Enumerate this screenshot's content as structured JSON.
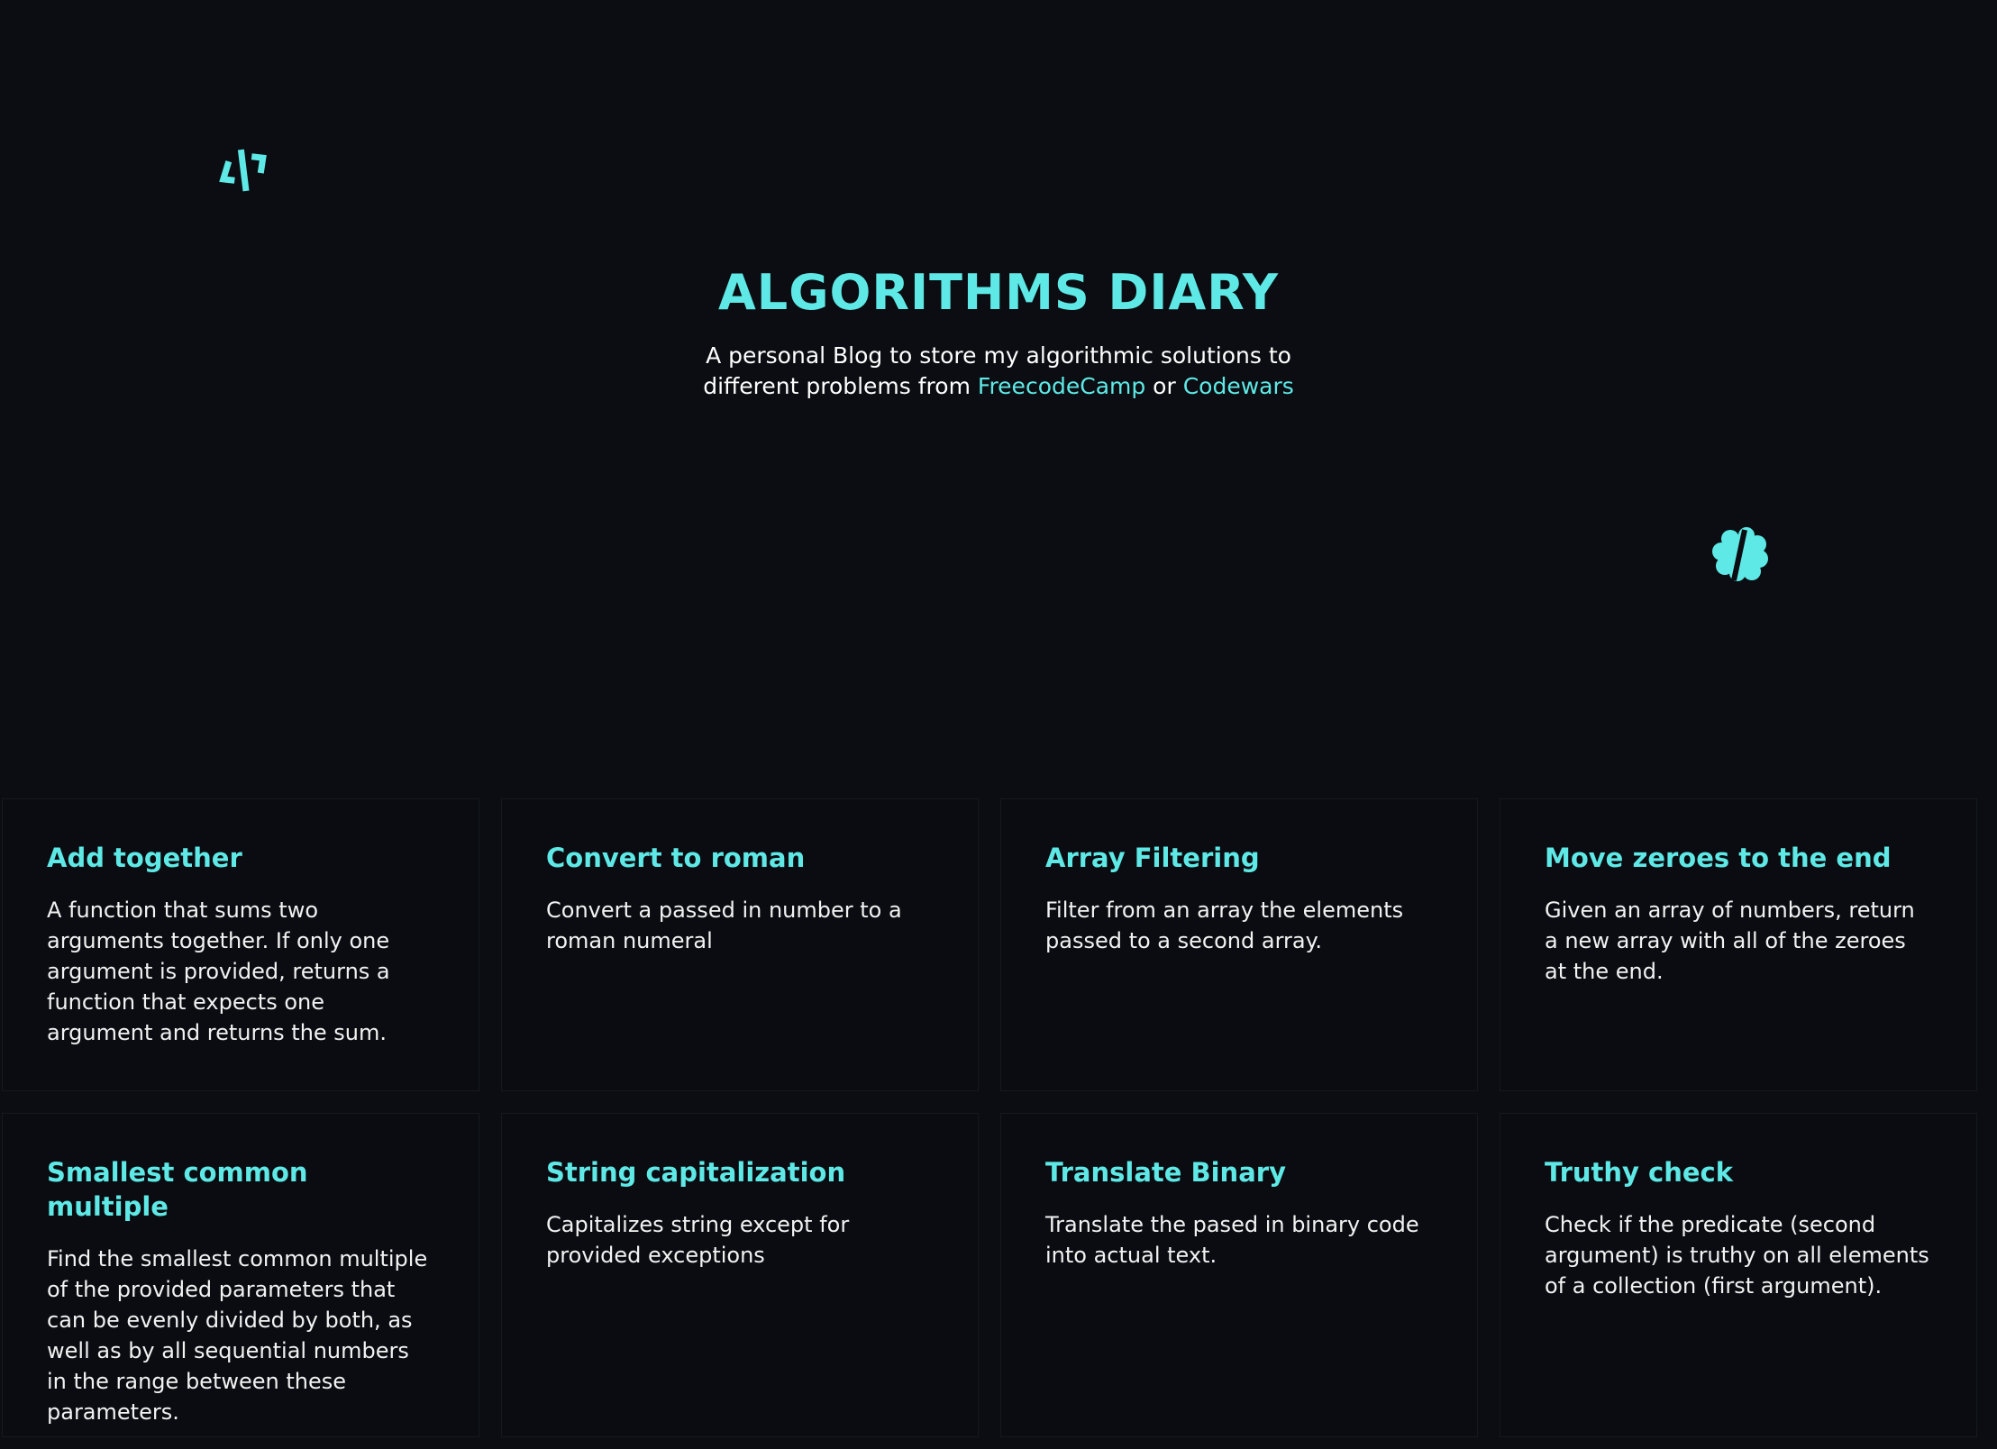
{
  "icons": {
    "top_left": "code-icon",
    "right": "brain-icon",
    "accent_color": "#5ee9e6"
  },
  "hero": {
    "title": "ALGORITHMS DIARY",
    "subtitle_part1": "A personal Blog to store my algorithmic solutions to different problems from ",
    "link_freecodecamp": "FreecodeCamp",
    "subtitle_or": " or ",
    "link_codewars": "Codewars"
  },
  "cards": [
    {
      "title": "Add together",
      "description": "A function that sums two arguments together. If only one argument is provided, returns a function that expects one argument and returns the sum."
    },
    {
      "title": "Convert to roman",
      "description": "Convert a passed in number to a roman numeral"
    },
    {
      "title": "Array Filtering",
      "description": "Filter from an array the elements passed to a second array."
    },
    {
      "title": "Move zeroes to the end",
      "description": "Given an array of numbers, return a new array with all of the zeroes at the end."
    },
    {
      "title": "Smallest common multiple",
      "description": "Find the smallest common multiple of the provided parameters that can be evenly divided by both, as well as by all sequential numbers in the range between these parameters."
    },
    {
      "title": "String capitalization",
      "description": "Capitalizes string except for provided exceptions"
    },
    {
      "title": "Translate Binary",
      "description": "Translate the pased in binary code into actual text."
    },
    {
      "title": "Truthy check",
      "description": "Check if the predicate (second argument) is truthy on all elements of a collection (first argument)."
    }
  ]
}
